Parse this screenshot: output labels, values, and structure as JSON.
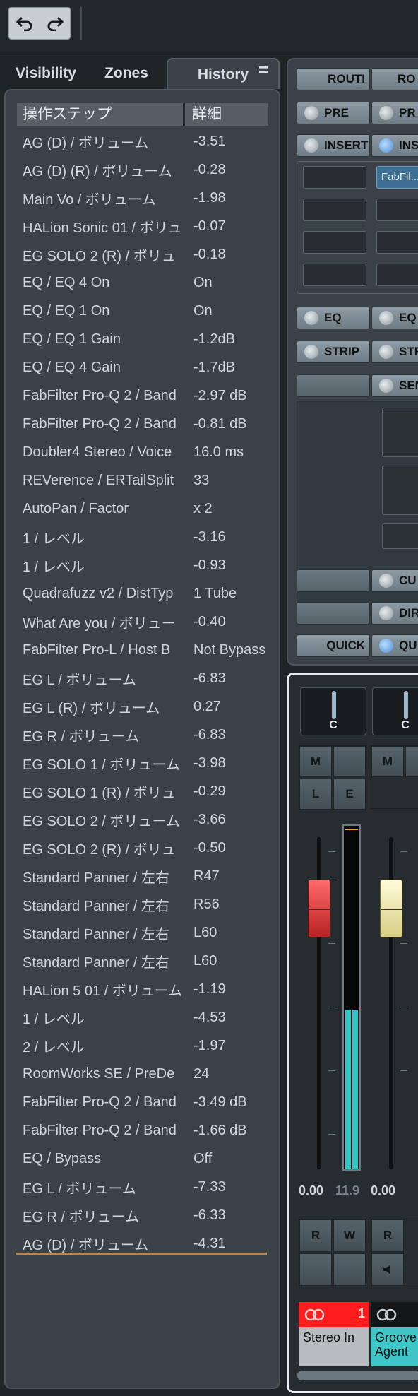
{
  "toolbar": {
    "undo_icon": "undo-icon",
    "redo_icon": "redo-icon"
  },
  "tabs": [
    {
      "label": "Visibility"
    },
    {
      "label": "Zones"
    },
    {
      "label": "History"
    }
  ],
  "tab_menu": "=",
  "history": {
    "headers": {
      "step": "操作ステップ",
      "detail": "詳細"
    },
    "rows": [
      {
        "step": "AG (D) / ボリューム",
        "detail": "-3.51"
      },
      {
        "step": "AG (D) (R) / ボリューム",
        "detail": "-0.28"
      },
      {
        "step": "Main Vo / ボリューム",
        "detail": "-1.98"
      },
      {
        "step": "HALion Sonic 01 / ボリュ",
        "detail": "-0.07"
      },
      {
        "step": "EG SOLO 2 (R) / ボリュ",
        "detail": "-0.18"
      },
      {
        "step": "EQ / EQ 4 On",
        "detail": "On"
      },
      {
        "step": "EQ / EQ 1 On",
        "detail": "On"
      },
      {
        "step": "EQ / EQ 1 Gain",
        "detail": "-1.2dB"
      },
      {
        "step": "EQ / EQ 4 Gain",
        "detail": "-1.7dB"
      },
      {
        "step": "FabFilter Pro-Q 2 / Band",
        "detail": "-2.97 dB"
      },
      {
        "step": "FabFilter Pro-Q 2 / Band",
        "detail": "-0.81 dB"
      },
      {
        "step": "Doubler4 Stereo / Voice",
        "detail": "16.0 ms"
      },
      {
        "step": "REVerence / ERTailSplit",
        "detail": "33"
      },
      {
        "step": "AutoPan / Factor",
        "detail": "x 2"
      },
      {
        "step": "1 / レベル",
        "detail": "-3.16"
      },
      {
        "step": "1 / レベル",
        "detail": "-0.93"
      },
      {
        "step": "Quadrafuzz v2 / DistTyp",
        "detail": "1 Tube"
      },
      {
        "step": "What Are you / ボリュー",
        "detail": "-0.40"
      },
      {
        "step": "FabFilter Pro-L / Host B",
        "detail": "Not Bypass"
      },
      {
        "step": "EG L / ボリューム",
        "detail": "-6.83"
      },
      {
        "step": "EG L (R) / ボリューム",
        "detail": "0.27"
      },
      {
        "step": "EG R / ボリューム",
        "detail": "-6.83"
      },
      {
        "step": "EG SOLO 1 / ボリューム",
        "detail": "-3.98"
      },
      {
        "step": "EG SOLO 1 (R) / ボリュ",
        "detail": "-0.29"
      },
      {
        "step": "EG SOLO 2 / ボリューム",
        "detail": "-3.66"
      },
      {
        "step": "EG SOLO 2 (R) / ボリュ",
        "detail": "-0.50"
      },
      {
        "step": "Standard Panner / 左右",
        "detail": "R47"
      },
      {
        "step": "Standard Panner / 左右",
        "detail": "R56"
      },
      {
        "step": "Standard Panner / 左右",
        "detail": "L60"
      },
      {
        "step": "Standard Panner / 左右",
        "detail": "L60"
      },
      {
        "step": "HALion 5 01 / ボリューム",
        "detail": "-1.19"
      },
      {
        "step": "1 / レベル",
        "detail": "-4.53"
      },
      {
        "step": "2 / レベル",
        "detail": "-1.97"
      },
      {
        "step": "RoomWorks SE / PreDe",
        "detail": "24"
      },
      {
        "step": "FabFilter Pro-Q 2 / Band",
        "detail": "-3.49 dB"
      },
      {
        "step": "FabFilter Pro-Q 2 / Band",
        "detail": "-1.66 dB"
      },
      {
        "step": "EQ / Bypass",
        "detail": "Off"
      },
      {
        "step": "EG L / ボリューム",
        "detail": "-7.33"
      },
      {
        "step": "EG R / ボリューム",
        "detail": "-6.33"
      },
      {
        "step": "AG (D) / ボリューム",
        "detail": "-4.31"
      }
    ]
  },
  "routing": {
    "routing_a": "ROUTI",
    "routing_b": "RO",
    "pre_a": "PRE",
    "pre_b": "PR",
    "inserts_a": "INSERT",
    "inserts_b": "INS",
    "insert_plugin": "FabFil...",
    "eq_a": "EQ",
    "eq_b": "EQ",
    "strip_a": "STRIP",
    "strip_b": "STR",
    "sends_b": "SEN",
    "cue_b": "CU",
    "direct_b": "DIR",
    "quick_a": "QUICK",
    "quick_b": "QU"
  },
  "mixer": {
    "pan_a": "C",
    "pan_b": "C",
    "mute": "M",
    "listen": "L",
    "edit": "E",
    "read": "R",
    "write": "W",
    "volume_a": "0.00",
    "peak_a": "11.9",
    "volume_b": "0.00",
    "channel_a_number": "1",
    "channel_a_name": "Stereo In",
    "channel_b_name": "Groove Agent",
    "channel_a_color": "#ff1c1c",
    "channel_b_color": "#3ec6c8",
    "fader_a_color": "#e03a3a",
    "fader_b_color": "#f4efb1"
  }
}
